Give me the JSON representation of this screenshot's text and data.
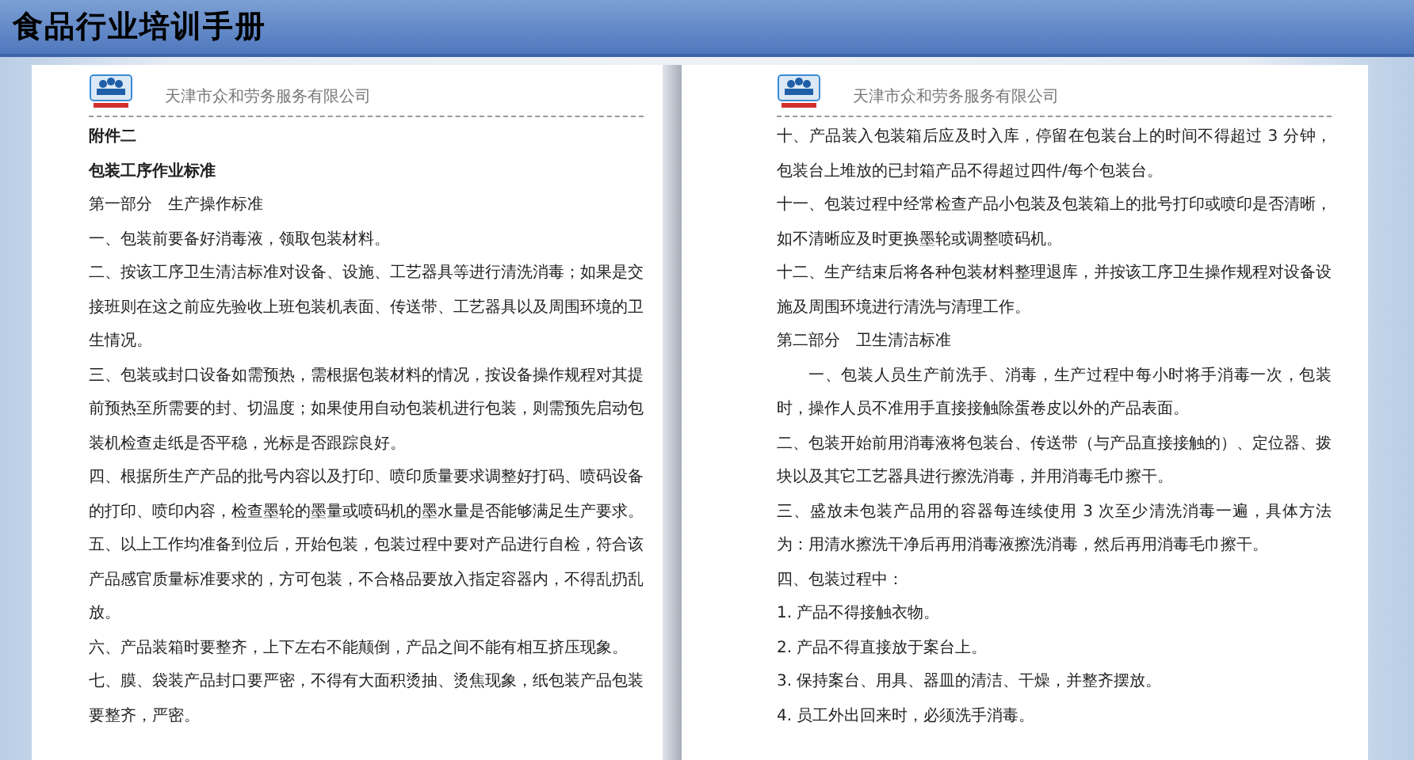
{
  "title": "食品行业培训手册",
  "pages": [
    {
      "company": "天津市众和劳务服务有限公司",
      "paragraphs": [
        {
          "kind": "heading",
          "text": "附件二"
        },
        {
          "kind": "heading",
          "text": "包装工序作业标准"
        },
        {
          "kind": "body",
          "text": "第一部分　生产操作标准"
        },
        {
          "kind": "body",
          "text": "一、包装前要备好消毒液，领取包装材料。"
        },
        {
          "kind": "body",
          "text": "二、按该工序卫生清洁标准对设备、设施、工艺器具等进行清洗消毒；如果是交接班则在这之前应先验收上班包装机表面、传送带、工艺器具以及周围环境的卫生情况。"
        },
        {
          "kind": "body",
          "text": "三、包装或封口设备如需预热，需根据包装材料的情况，按设备操作规程对其提前预热至所需要的封、切温度；如果使用自动包装机进行包装，则需预先启动包装机检查走纸是否平稳，光标是否跟踪良好。"
        },
        {
          "kind": "body",
          "text": "四、根据所生产产品的批号内容以及打印、喷印质量要求调整好打码、喷码设备的打印、喷印内容，检查墨轮的墨量或喷码机的墨水量是否能够满足生产要求。"
        },
        {
          "kind": "body",
          "text": "五、以上工作均准备到位后，开始包装，包装过程中要对产品进行自检，符合该产品感官质量标准要求的，方可包装，不合格品要放入指定容器内，不得乱扔乱放。"
        },
        {
          "kind": "body",
          "text": "六、产品装箱时要整齐，上下左右不能颠倒，产品之间不能有相互挤压现象。"
        },
        {
          "kind": "body",
          "text": "七、膜、袋装产品封口要严密，不得有大面积烫抽、烫焦现象，纸包装产品包装要整齐，严密。"
        }
      ]
    },
    {
      "company": "天津市众和劳务服务有限公司",
      "paragraphs": [
        {
          "kind": "body",
          "text": "十、产品装入包装箱后应及时入库，停留在包装台上的时间不得超过 3 分钟，包装台上堆放的已封箱产品不得超过四件/每个包装台。"
        },
        {
          "kind": "body",
          "text": "十一、包装过程中经常检查产品小包装及包装箱上的批号打印或喷印是否清晰，如不清晰应及时更换墨轮或调整喷码机。"
        },
        {
          "kind": "body",
          "text": "十二、生产结束后将各种包装材料整理退库，并按该工序卫生操作规程对设备设施及周围环境进行清洗与清理工作。"
        },
        {
          "kind": "body",
          "text": "第二部分　卫生清洁标准"
        },
        {
          "kind": "indented",
          "text": "一、包装人员生产前洗手、消毒，生产过程中每小时将手消毒一次，包装时，操作人员不准用手直接接触除蛋卷皮以外的产品表面。"
        },
        {
          "kind": "body",
          "text": "二、包装开始前用消毒液将包装台、传送带（与产品直接接触的）、定位器、拨块以及其它工艺器具进行擦洗消毒，并用消毒毛巾擦干。"
        },
        {
          "kind": "body",
          "text": "三、盛放未包装产品用的容器每连续使用 3 次至少清洗消毒一遍，具体方法为：用清水擦洗干净后再用消毒液擦洗消毒，然后再用消毒毛巾擦干。"
        },
        {
          "kind": "body",
          "text": "四、包装过程中："
        },
        {
          "kind": "body",
          "text": "1. 产品不得接触衣物。"
        },
        {
          "kind": "body",
          "text": "2. 产品不得直接放于案台上。"
        },
        {
          "kind": "body",
          "text": "3. 保持案台、用具、器皿的清洁、干燥，并整齐摆放。"
        },
        {
          "kind": "body",
          "text": "4. 员工外出回来时，必须洗手消毒。"
        }
      ]
    }
  ]
}
